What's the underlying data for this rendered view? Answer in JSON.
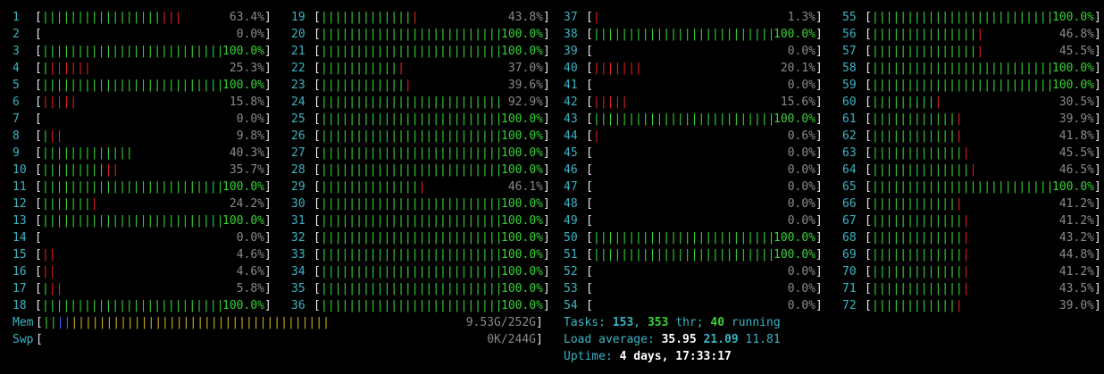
{
  "cpu_columns": [
    [
      {
        "n": "1",
        "pct": "63.4%",
        "g": 17,
        "r": 3
      },
      {
        "n": "2",
        "pct": "0.0%",
        "g": 0,
        "r": 0
      },
      {
        "n": "3",
        "pct": "100.0%",
        "g": 26,
        "r": 0
      },
      {
        "n": "4",
        "pct": "25.3%",
        "g": 1,
        "r": 6
      },
      {
        "n": "5",
        "pct": "100.0%",
        "g": 26,
        "r": 0
      },
      {
        "n": "6",
        "pct": "15.8%",
        "g": 0,
        "r": 5
      },
      {
        "n": "7",
        "pct": "0.0%",
        "g": 0,
        "r": 0
      },
      {
        "n": "8",
        "pct": "9.8%",
        "g": 1,
        "r": 2
      },
      {
        "n": "9",
        "pct": "40.3%",
        "g": 13,
        "r": 0
      },
      {
        "n": "10",
        "pct": "35.7%",
        "g": 9,
        "r": 2
      },
      {
        "n": "11",
        "pct": "100.0%",
        "g": 26,
        "r": 0
      },
      {
        "n": "12",
        "pct": "24.2%",
        "g": 7,
        "r": 1
      },
      {
        "n": "13",
        "pct": "100.0%",
        "g": 26,
        "r": 0
      },
      {
        "n": "14",
        "pct": "0.0%",
        "g": 0,
        "r": 0
      },
      {
        "n": "15",
        "pct": "4.6%",
        "g": 0,
        "r": 2
      },
      {
        "n": "16",
        "pct": "4.6%",
        "g": 0,
        "r": 2
      },
      {
        "n": "17",
        "pct": "5.8%",
        "g": 1,
        "r": 2
      },
      {
        "n": "18",
        "pct": "100.0%",
        "g": 26,
        "r": 0
      }
    ],
    [
      {
        "n": "19",
        "pct": "43.8%",
        "g": 13,
        "r": 1
      },
      {
        "n": "20",
        "pct": "100.0%",
        "g": 26,
        "r": 0
      },
      {
        "n": "21",
        "pct": "100.0%",
        "g": 26,
        "r": 0
      },
      {
        "n": "22",
        "pct": "37.0%",
        "g": 11,
        "r": 1
      },
      {
        "n": "23",
        "pct": "39.6%",
        "g": 12,
        "r": 1
      },
      {
        "n": "24",
        "pct": "92.9%",
        "g": 26,
        "r": 0
      },
      {
        "n": "25",
        "pct": "100.0%",
        "g": 26,
        "r": 0
      },
      {
        "n": "26",
        "pct": "100.0%",
        "g": 26,
        "r": 0
      },
      {
        "n": "27",
        "pct": "100.0%",
        "g": 26,
        "r": 0
      },
      {
        "n": "28",
        "pct": "100.0%",
        "g": 26,
        "r": 0
      },
      {
        "n": "29",
        "pct": "46.1%",
        "g": 14,
        "r": 1
      },
      {
        "n": "30",
        "pct": "100.0%",
        "g": 26,
        "r": 0
      },
      {
        "n": "31",
        "pct": "100.0%",
        "g": 26,
        "r": 0
      },
      {
        "n": "32",
        "pct": "100.0%",
        "g": 26,
        "r": 0
      },
      {
        "n": "33",
        "pct": "100.0%",
        "g": 26,
        "r": 0
      },
      {
        "n": "34",
        "pct": "100.0%",
        "g": 26,
        "r": 0
      },
      {
        "n": "35",
        "pct": "100.0%",
        "g": 26,
        "r": 0
      },
      {
        "n": "36",
        "pct": "100.0%",
        "g": 26,
        "r": 0
      }
    ],
    [
      {
        "n": "37",
        "pct": "1.3%",
        "g": 0,
        "r": 1
      },
      {
        "n": "38",
        "pct": "100.0%",
        "g": 26,
        "r": 0
      },
      {
        "n": "39",
        "pct": "0.0%",
        "g": 0,
        "r": 0
      },
      {
        "n": "40",
        "pct": "20.1%",
        "g": 0,
        "r": 7
      },
      {
        "n": "41",
        "pct": "0.0%",
        "g": 0,
        "r": 0
      },
      {
        "n": "42",
        "pct": "15.6%",
        "g": 0,
        "r": 5
      },
      {
        "n": "43",
        "pct": "100.0%",
        "g": 26,
        "r": 0
      },
      {
        "n": "44",
        "pct": "0.6%",
        "g": 0,
        "r": 1
      },
      {
        "n": "45",
        "pct": "0.0%",
        "g": 0,
        "r": 0
      },
      {
        "n": "46",
        "pct": "0.0%",
        "g": 0,
        "r": 0
      },
      {
        "n": "47",
        "pct": "0.0%",
        "g": 0,
        "r": 0
      },
      {
        "n": "48",
        "pct": "0.0%",
        "g": 0,
        "r": 0
      },
      {
        "n": "49",
        "pct": "0.0%",
        "g": 0,
        "r": 0
      },
      {
        "n": "50",
        "pct": "100.0%",
        "g": 26,
        "r": 0
      },
      {
        "n": "51",
        "pct": "100.0%",
        "g": 26,
        "r": 0
      },
      {
        "n": "52",
        "pct": "0.0%",
        "g": 0,
        "r": 0
      },
      {
        "n": "53",
        "pct": "0.0%",
        "g": 0,
        "r": 0
      },
      {
        "n": "54",
        "pct": "0.0%",
        "g": 0,
        "r": 0
      }
    ],
    [
      {
        "n": "55",
        "pct": "100.0%",
        "g": 26,
        "r": 0
      },
      {
        "n": "56",
        "pct": "46.8%",
        "g": 15,
        "r": 1
      },
      {
        "n": "57",
        "pct": "45.5%",
        "g": 15,
        "r": 1
      },
      {
        "n": "58",
        "pct": "100.0%",
        "g": 26,
        "r": 0
      },
      {
        "n": "59",
        "pct": "100.0%",
        "g": 26,
        "r": 0
      },
      {
        "n": "60",
        "pct": "30.5%",
        "g": 9,
        "r": 1
      },
      {
        "n": "61",
        "pct": "39.9%",
        "g": 12,
        "r": 1
      },
      {
        "n": "62",
        "pct": "41.8%",
        "g": 12,
        "r": 1
      },
      {
        "n": "63",
        "pct": "45.5%",
        "g": 13,
        "r": 1
      },
      {
        "n": "64",
        "pct": "46.5%",
        "g": 14,
        "r": 1
      },
      {
        "n": "65",
        "pct": "100.0%",
        "g": 26,
        "r": 0
      },
      {
        "n": "66",
        "pct": "41.2%",
        "g": 12,
        "r": 1
      },
      {
        "n": "67",
        "pct": "41.2%",
        "g": 13,
        "r": 1
      },
      {
        "n": "68",
        "pct": "43.2%",
        "g": 13,
        "r": 1
      },
      {
        "n": "69",
        "pct": "44.8%",
        "g": 13,
        "r": 1
      },
      {
        "n": "70",
        "pct": "41.2%",
        "g": 13,
        "r": 1
      },
      {
        "n": "71",
        "pct": "43.5%",
        "g": 13,
        "r": 1
      },
      {
        "n": "72",
        "pct": "39.0%",
        "g": 12,
        "r": 1
      }
    ]
  ],
  "mem": {
    "label": "Mem",
    "value": "9.53G/252G",
    "segs": {
      "g": 2,
      "b": 2,
      "y": 37
    }
  },
  "swp": {
    "label": "Swp",
    "value": "0K/244G"
  },
  "tasks": {
    "label": "Tasks: ",
    "count": "153",
    "sep1": ", ",
    "thr": "353",
    "thr_label": " thr; ",
    "running": "40",
    "running_label": " running"
  },
  "load": {
    "label": "Load average: ",
    "l1": "35.95",
    "l5": "21.09",
    "l15": "11.81"
  },
  "uptime": {
    "label": "Uptime: ",
    "value": "4 days, 17:33:17"
  },
  "colors": {
    "green": "#35d235",
    "red": "#e02020",
    "cyan": "#3ab4c4",
    "yellow": "#c8b020",
    "blue": "#3060ff"
  }
}
